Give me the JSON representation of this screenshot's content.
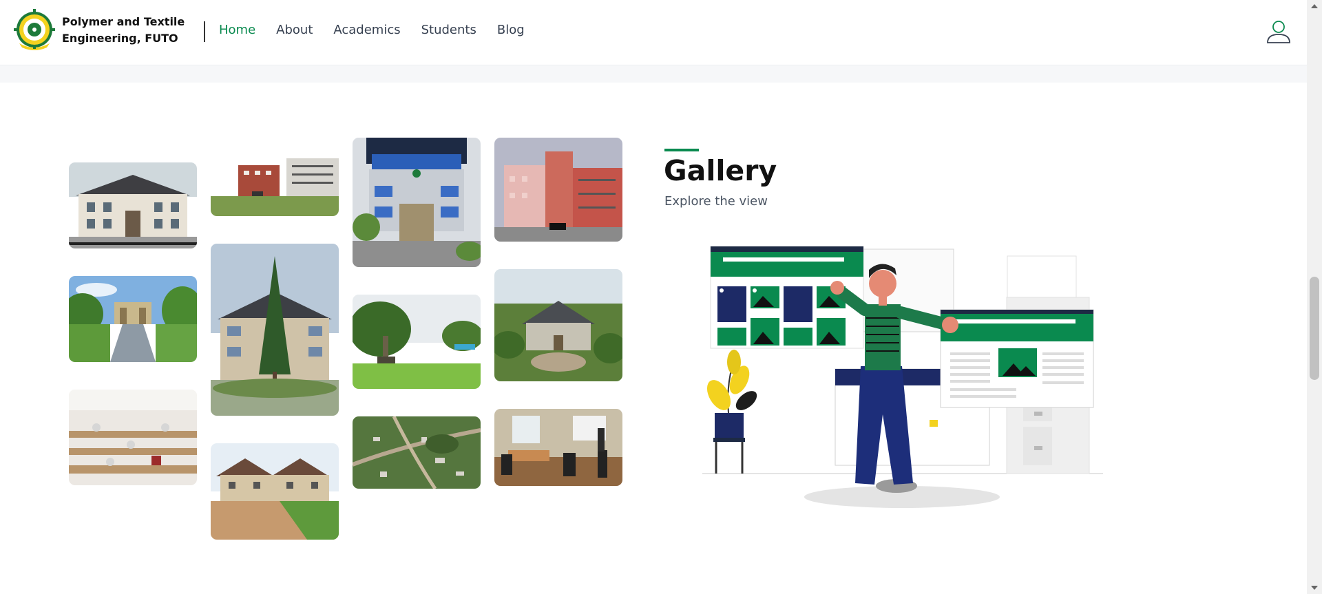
{
  "header": {
    "brand_name": "Polymer and Textile Engineering, FUTO",
    "nav": [
      {
        "label": "Home",
        "active": true
      },
      {
        "label": "About",
        "active": false
      },
      {
        "label": "Academics",
        "active": false
      },
      {
        "label": "Students",
        "active": false
      },
      {
        "label": "Blog",
        "active": false
      }
    ],
    "user_icon": "user-icon"
  },
  "gallery": {
    "title": "Gallery",
    "subtitle": "Explore the view",
    "photos": [
      "admin-building",
      "campus-buildings-field",
      "blue-window-building",
      "red-building",
      "campus-gate",
      "tree-building",
      "statue-garden",
      "aerial-campus",
      "exam-hall",
      "aerial-road-view",
      "hut-building",
      "computer-lab"
    ]
  },
  "colors": {
    "accent": "#0a8a4f",
    "text_dark": "#111111",
    "text_muted": "#4b5563"
  }
}
